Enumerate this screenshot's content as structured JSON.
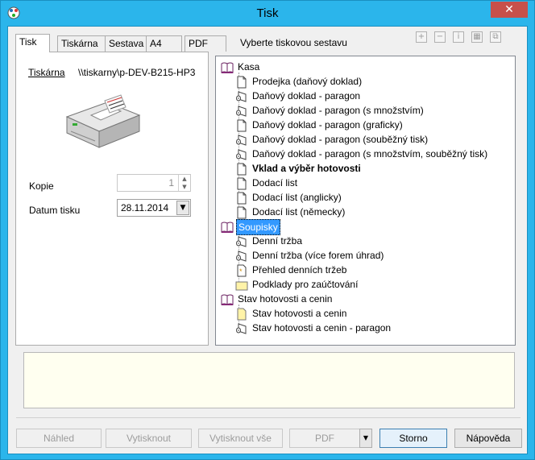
{
  "window": {
    "title": "Tisk",
    "close_glyph": "✕"
  },
  "tabs": [
    {
      "label": "Tisk",
      "active": true
    },
    {
      "label": "Tiskárna",
      "active": false
    },
    {
      "label": "Sestava",
      "active": false
    },
    {
      "label": "A4",
      "active": false
    },
    {
      "label": "PDF",
      "active": false
    }
  ],
  "hint": "Vyberte tiskovou sestavu",
  "toolbar": {
    "icons": [
      "expand-icon",
      "collapse-icon",
      "info-icon",
      "add-report-icon",
      "copy-report-icon"
    ],
    "glyphs": [
      "+",
      "−",
      "i",
      "▦",
      "⧉"
    ]
  },
  "printer": {
    "label": "Tiskárna",
    "value": "\\\\tiskarny\\p-DEV-B215-HP3"
  },
  "copies": {
    "label": "Kopie",
    "value": "1"
  },
  "date": {
    "label": "Datum tisku",
    "value": "28.11.2014"
  },
  "tree": [
    {
      "label": "Kasa",
      "level": 0,
      "icon": "book-icon"
    },
    {
      "label": "Prodejka (daňový doklad)",
      "level": 1,
      "icon": "document-icon"
    },
    {
      "label": "Daňový doklad - paragon",
      "level": 1,
      "icon": "receipt-roll-icon"
    },
    {
      "label": "Daňový doklad - paragon (s množstvím)",
      "level": 1,
      "icon": "receipt-roll-icon"
    },
    {
      "label": "Daňový doklad - paragon (graficky)",
      "level": 1,
      "icon": "document-icon"
    },
    {
      "label": "Daňový doklad - paragon (souběžný tisk)",
      "level": 1,
      "icon": "receipt-roll-icon"
    },
    {
      "label": "Daňový doklad - paragon (s množstvím, souběžný tisk)",
      "level": 1,
      "icon": "receipt-roll-icon"
    },
    {
      "label": "Vklad a výběr hotovosti",
      "level": 1,
      "icon": "document-icon",
      "bold": true
    },
    {
      "label": "Dodací list",
      "level": 1,
      "icon": "document-icon"
    },
    {
      "label": "Dodací list (anglicky)",
      "level": 1,
      "icon": "document-icon"
    },
    {
      "label": "Dodací list (německy)",
      "level": 1,
      "icon": "document-icon"
    },
    {
      "label": "Soupisky",
      "level": 0,
      "icon": "book-icon",
      "selected": true
    },
    {
      "label": "Denní tržba",
      "level": 1,
      "icon": "receipt-roll-icon"
    },
    {
      "label": "Denní tržba (více forem úhrad)",
      "level": 1,
      "icon": "receipt-roll-icon"
    },
    {
      "label": "Přehled denních tržeb",
      "level": 1,
      "icon": "starred-document-icon"
    },
    {
      "label": "Podklady pro zaúčtování",
      "level": 1,
      "icon": "yellow-folder-icon"
    },
    {
      "label": "Stav hotovosti a cenin",
      "level": 0,
      "icon": "book-icon"
    },
    {
      "label": "Stav hotovosti a cenin",
      "level": 1,
      "icon": "yellow-document-icon"
    },
    {
      "label": "Stav hotovosti a cenin - paragon",
      "level": 1,
      "icon": "receipt-roll-icon"
    }
  ],
  "buttons": {
    "preview": "Náhled",
    "print": "Vytisknout",
    "print_all": "Vytisknout vše",
    "pdf": "PDF",
    "pdf_arrow": "▼",
    "cancel": "Storno",
    "help": "Nápověda"
  },
  "colors": {
    "titlebar": "#2bb5eb",
    "selection": "#3399ff",
    "memo_bg": "#fffff0"
  }
}
